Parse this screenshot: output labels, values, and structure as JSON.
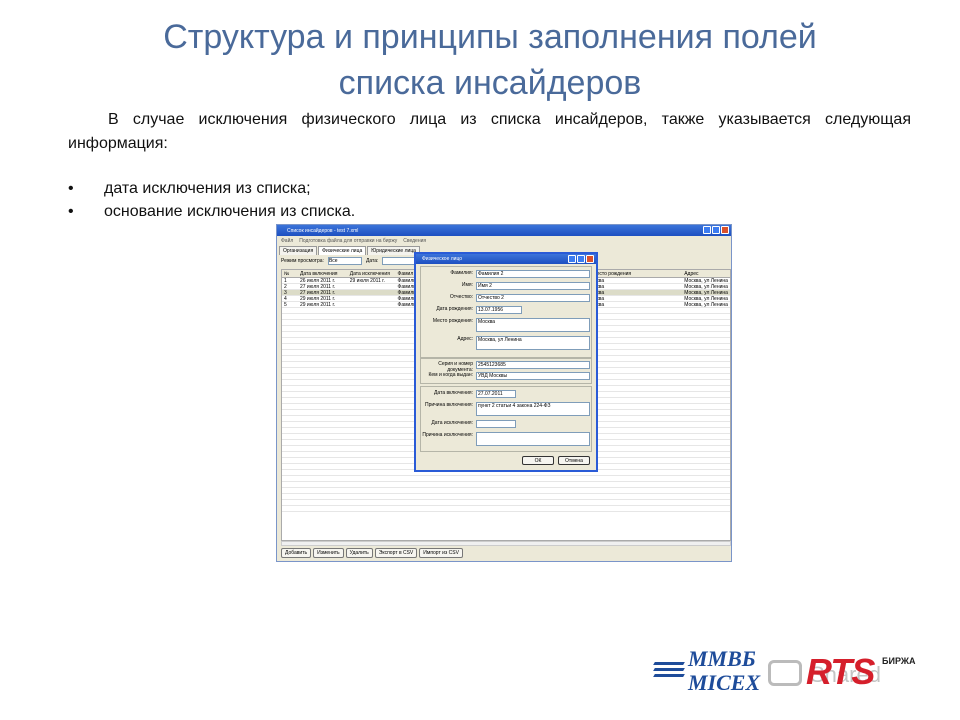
{
  "slide": {
    "title_line1": "Структура и принципы заполнения полей",
    "title_line2": "списка инсайдеров",
    "paragraph": "В случае исключения физического лица из списка инсайдеров, также указывается следующая информация:",
    "bullets": [
      "дата исключения из списка;",
      "основание исключения из списка."
    ]
  },
  "window": {
    "title": "Список инсайдеров - test 7.xml",
    "menu": [
      "Файл",
      "Подготовка файла для отправки на биржу",
      "Сведения"
    ],
    "tabs": [
      "Организация",
      "Физические лица",
      "Юридические лица"
    ],
    "filter_label": "Режим просмотра:",
    "filter_value": "Все",
    "date_label": "Дата:",
    "columns": [
      "№",
      "Дата включения",
      "Дата исключения",
      "Фамил",
      "есто рождения",
      "Адрес"
    ],
    "rows": [
      {
        "n": "1",
        "incl": "26 июля 2011 г.",
        "excl": "29 июля 2011 г.",
        "fam": "Фамили",
        "place": "ква",
        "addr": "Москва, ул Ленина"
      },
      {
        "n": "2",
        "incl": "27 июля 2011 г.",
        "excl": "",
        "fam": "Фамили",
        "place": "ква",
        "addr": "Москва, ул Ленина"
      },
      {
        "n": "3",
        "incl": "27 июля 2011 г.",
        "excl": "",
        "fam": "Фамили",
        "place": "ква",
        "addr": "Москва, ул Ленина"
      },
      {
        "n": "4",
        "incl": "29 июля 2011 г.",
        "excl": "",
        "fam": "Фамили",
        "place": "ква",
        "addr": "Москва, ул Ленина"
      },
      {
        "n": "5",
        "incl": "29 июля 2011 г.",
        "excl": "",
        "fam": "Фамили",
        "place": "ква",
        "addr": "Москва, ул Ленина"
      }
    ],
    "buttons": [
      "Добавить",
      "Изменить",
      "Удалить",
      "Экспорт в CSV",
      "Импорт из CSV"
    ]
  },
  "dialog": {
    "title": "Физическое лицо",
    "fields": {
      "surname_label": "Фамилия:",
      "surname": "Фамилия 2",
      "name_label": "Имя:",
      "name": "Имя 2",
      "patronymic_label": "Отчество:",
      "patronymic": "Отчество 2",
      "birthdate_label": "Дата рождения:",
      "birthdate": "13.07.1956",
      "birthplace_label": "Место рождения:",
      "birthplace": "Москва",
      "address_label": "Адрес:",
      "address": "Москва, ул Ленина",
      "doc_label": "Серия и номер документа:",
      "doc": "2545123685",
      "issued_label": "Кем и когда выдан:",
      "issued": "УВД Москвы",
      "incl_date_label": "Дата включения:",
      "incl_date": "27.07.2011",
      "incl_reason_label": "Причина включения:",
      "incl_reason": "пункт 2 статьи 4 закона 224-ФЗ",
      "excl_date_label": "Дата исключения:",
      "excl_date": "",
      "excl_reason_label": "Причина исключения:",
      "excl_reason": ""
    },
    "ok": "ОК",
    "cancel": "Отмена"
  },
  "logos": {
    "mmvb_line1": "ММВБ",
    "mmvb_line2": "MICEX",
    "rts": "RTS",
    "birzha": "БИРЖА",
    "watermark": "Shared",
    "brand_blue": "#1e4c9a",
    "brand_red": "#d51f2b"
  }
}
